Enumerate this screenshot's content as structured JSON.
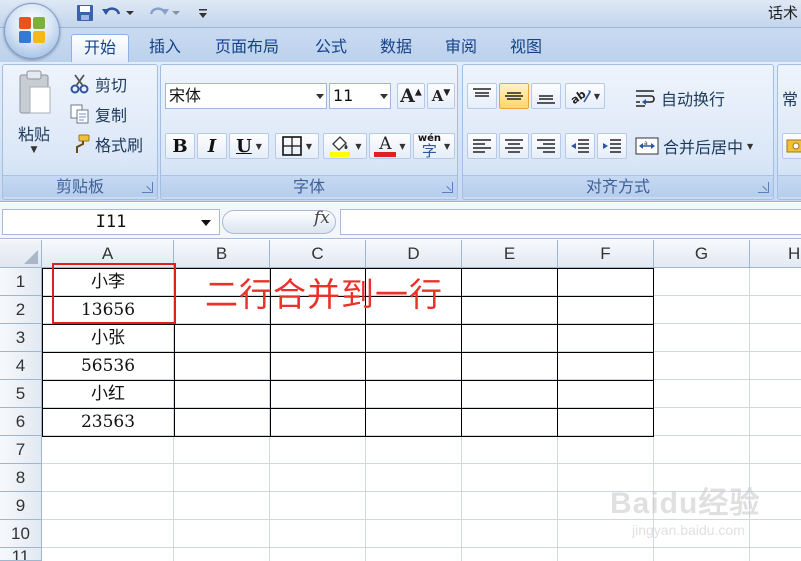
{
  "window": {
    "title": "话术"
  },
  "ribbon_tabs": [
    {
      "label": "开始",
      "active": true
    },
    {
      "label": "插入"
    },
    {
      "label": "页面布局"
    },
    {
      "label": "公式"
    },
    {
      "label": "数据"
    },
    {
      "label": "审阅"
    },
    {
      "label": "视图"
    }
  ],
  "clipboard": {
    "group_label": "剪贴板",
    "paste_label": "粘贴",
    "cut_label": "剪切",
    "copy_label": "复制",
    "format_painter_label": "格式刷"
  },
  "font": {
    "group_label": "字体",
    "font_name": "宋体",
    "font_size": "11",
    "bold_label": "B",
    "italic_label": "I",
    "underline_label": "U",
    "font_color_glyph": "A",
    "highlight_color": "#ffff00",
    "font_color": "#e02020",
    "phonetic_label": "wén"
  },
  "alignment": {
    "group_label": "对齐方式",
    "wrap_text_label": "自动换行",
    "merge_center_label": "合并后居中"
  },
  "number": {
    "format_partial": "常"
  },
  "formula_bar": {
    "name_box": "I11",
    "fx_label": "fx",
    "formula": ""
  },
  "sheet": {
    "columns": [
      "A",
      "B",
      "C",
      "D",
      "E",
      "F",
      "G",
      "H"
    ],
    "rows": [
      "1",
      "2",
      "3",
      "4",
      "5",
      "6",
      "7",
      "8",
      "9",
      "10",
      "11"
    ],
    "column_a_values": [
      "小李",
      "13656",
      "小张",
      "56536",
      "小红",
      "23563"
    ]
  },
  "annotation": {
    "text": "二行合并到一行",
    "color": "#e8322a"
  },
  "watermark": {
    "logo": "Baidu经验",
    "url": "jingyan.baidu.com"
  },
  "colors": {
    "ribbon_bg": "#dbe7f7",
    "tab_text": "#15428b",
    "grid_line": "#d0d7e5",
    "highlight_box": "#e02020"
  }
}
